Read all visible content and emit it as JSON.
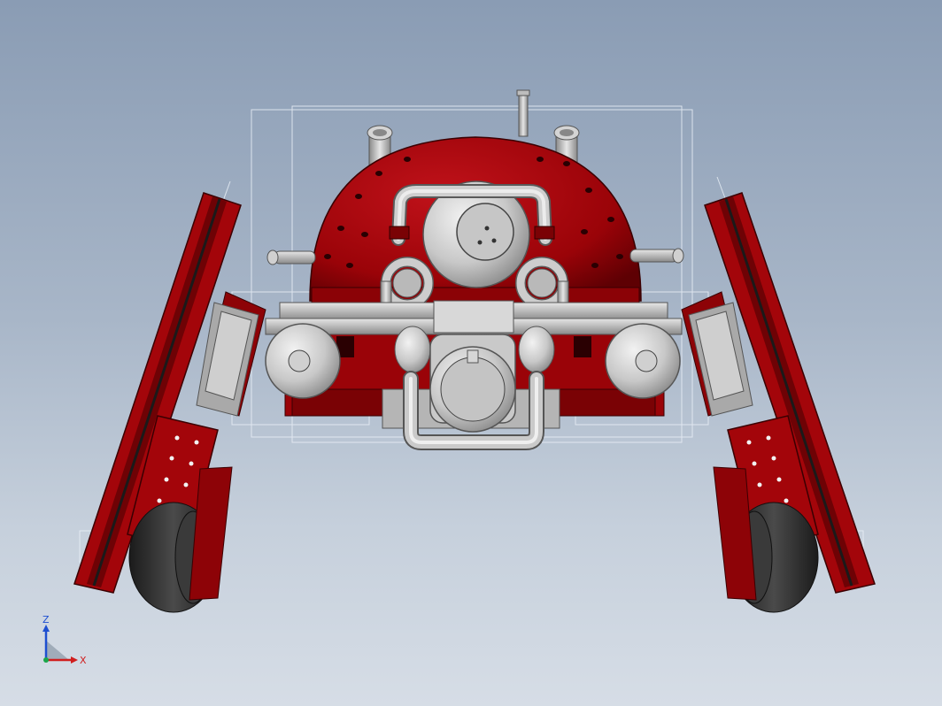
{
  "viewport": {
    "background_top": "#8a9cb4",
    "background_bottom": "#d6dde6"
  },
  "model": {
    "name": "",
    "body_color": "#a3050a",
    "body_dark": "#6e0205",
    "metal_color": "#c4c4c4",
    "metal_dark": "#8f8f8f",
    "tire_color": "#2c2c2c"
  },
  "triad": {
    "z_label": "Z",
    "x_label": "X",
    "z_color": "#1e4fd0",
    "x_color": "#d01e1e",
    "icon": "coordinate-triad-icon"
  }
}
